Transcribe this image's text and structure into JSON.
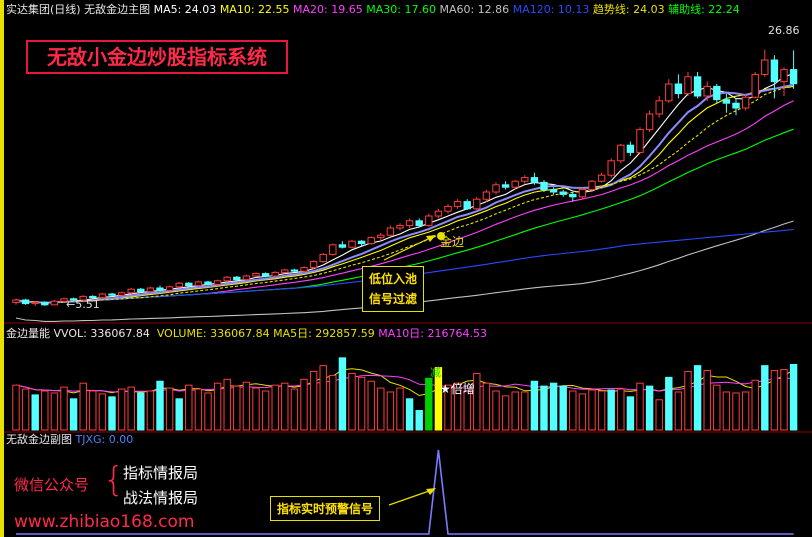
{
  "main_header": {
    "stock": "实达集团(日线)",
    "indicator": "无敌金边主图",
    "ma5": "MA5: 24.03",
    "ma10": "MA10: 22.55",
    "ma20": "MA20: 19.65",
    "ma30": "MA30: 17.60",
    "ma60": "MA60: 12.86",
    "ma120": "MA120: 10.13",
    "trend": "趋势线: 24.03",
    "aux": "辅助线: 22.24"
  },
  "brand_title": "无敌小金边炒股指标系统",
  "annotations": {
    "low_label": "←5.51",
    "high_label": "26.86",
    "golden_edge": "金边",
    "entry_line1": "低位入池",
    "entry_line2": "信号过滤",
    "volume_reduce": "减",
    "volume_double": "★倍增",
    "alert": "指标实时预警信号"
  },
  "volume_header": {
    "name": "金边量能",
    "vvol": "VVOL: 336067.84",
    "volume": "VOLUME: 336067.84",
    "ma5": "MA5日: 292857.59",
    "ma10": "MA10日: 216764.53"
  },
  "sub_header": {
    "name": "无敌金边副图",
    "tjxg": "TJXG: 0.00"
  },
  "promo": {
    "wechat": "微信公众号",
    "brace": "{",
    "item1": "指标情报局",
    "item2": "战法情报局",
    "site": "www.zhibiao168.com"
  },
  "colors": {
    "up": "#ff3c3c",
    "down": "#54ffff",
    "ma5": "#ffffff",
    "ma10": "#ffff00",
    "ma20": "#ff40ff",
    "ma30": "#00ff00",
    "ma60": "#c0c0c0",
    "ma120": "#2a48ff",
    "trend": "#8c8cff",
    "aux": "#e8e000",
    "brand": "#ff2a4a"
  },
  "chart_data": {
    "type": "candlestick",
    "price_range": [
      5.0,
      27.5
    ],
    "candles": [
      [
        5.8,
        6.0,
        5.6,
        6.1
      ],
      [
        6.0,
        5.7,
        5.6,
        6.1
      ],
      [
        5.7,
        5.8,
        5.5,
        5.9
      ],
      [
        5.8,
        5.6,
        5.51,
        5.9
      ],
      [
        5.6,
        5.9,
        5.55,
        6.0
      ],
      [
        5.9,
        6.1,
        5.8,
        6.2
      ],
      [
        6.1,
        6.0,
        5.9,
        6.2
      ],
      [
        6.0,
        6.3,
        5.9,
        6.4
      ],
      [
        6.3,
        6.2,
        6.1,
        6.4
      ],
      [
        6.2,
        6.5,
        6.1,
        6.6
      ],
      [
        6.5,
        6.4,
        6.3,
        6.6
      ],
      [
        6.4,
        6.6,
        6.3,
        6.7
      ],
      [
        6.6,
        6.9,
        6.5,
        7.0
      ],
      [
        6.9,
        6.7,
        6.6,
        7.0
      ],
      [
        6.7,
        7.0,
        6.6,
        7.1
      ],
      [
        7.0,
        6.8,
        6.7,
        7.2
      ],
      [
        6.8,
        7.1,
        6.7,
        7.2
      ],
      [
        7.1,
        7.4,
        7.0,
        7.5
      ],
      [
        7.4,
        7.2,
        7.1,
        7.5
      ],
      [
        7.2,
        7.5,
        7.1,
        7.6
      ],
      [
        7.5,
        7.3,
        7.2,
        7.6
      ],
      [
        7.3,
        7.6,
        7.2,
        7.7
      ],
      [
        7.6,
        7.9,
        7.5,
        8.0
      ],
      [
        7.9,
        7.7,
        7.6,
        8.0
      ],
      [
        7.7,
        8.0,
        7.6,
        8.1
      ],
      [
        8.0,
        8.2,
        7.9,
        8.3
      ],
      [
        8.2,
        8.0,
        7.9,
        8.3
      ],
      [
        8.0,
        8.3,
        7.9,
        8.4
      ],
      [
        8.3,
        8.5,
        8.2,
        8.6
      ],
      [
        8.5,
        8.4,
        8.3,
        8.6
      ],
      [
        8.4,
        8.7,
        8.3,
        8.8
      ],
      [
        8.7,
        9.2,
        8.6,
        9.3
      ],
      [
        9.2,
        9.8,
        9.1,
        9.9
      ],
      [
        9.8,
        10.6,
        9.7,
        10.7
      ],
      [
        10.6,
        10.4,
        10.3,
        10.9
      ],
      [
        10.4,
        10.9,
        10.3,
        11.0
      ],
      [
        10.9,
        10.7,
        10.5,
        11.0
      ],
      [
        10.7,
        11.2,
        10.6,
        11.3
      ],
      [
        11.2,
        11.4,
        11.0,
        11.6
      ],
      [
        11.4,
        12.0,
        11.3,
        12.2
      ],
      [
        12.0,
        12.2,
        11.8,
        12.4
      ],
      [
        12.2,
        12.6,
        12.0,
        12.8
      ],
      [
        12.6,
        12.2,
        12.1,
        12.8
      ],
      [
        12.2,
        13.0,
        12.1,
        13.2
      ],
      [
        13.0,
        13.4,
        12.8,
        13.6
      ],
      [
        13.4,
        13.8,
        13.2,
        14.0
      ],
      [
        13.8,
        14.2,
        13.6,
        14.4
      ],
      [
        14.2,
        13.6,
        13.5,
        14.4
      ],
      [
        13.6,
        14.4,
        13.5,
        14.6
      ],
      [
        14.4,
        15.0,
        14.2,
        15.2
      ],
      [
        15.0,
        15.6,
        14.8,
        15.8
      ],
      [
        15.6,
        15.4,
        15.2,
        15.9
      ],
      [
        15.4,
        15.9,
        15.2,
        16.0
      ],
      [
        15.9,
        16.2,
        15.7,
        16.4
      ],
      [
        16.2,
        15.8,
        15.6,
        16.6
      ],
      [
        15.8,
        15.2,
        15.0,
        16.0
      ],
      [
        15.2,
        15.0,
        14.8,
        15.4
      ],
      [
        15.0,
        14.8,
        14.6,
        15.2
      ],
      [
        14.8,
        14.6,
        14.2,
        15.0
      ],
      [
        14.6,
        15.2,
        14.4,
        15.4
      ],
      [
        15.2,
        15.9,
        15.0,
        16.0
      ],
      [
        15.9,
        16.4,
        15.8,
        16.6
      ],
      [
        16.4,
        17.6,
        16.2,
        17.8
      ],
      [
        17.6,
        18.9,
        17.4,
        19.0
      ],
      [
        18.9,
        18.3,
        18.0,
        19.2
      ],
      [
        18.3,
        20.2,
        18.2,
        20.4
      ],
      [
        20.2,
        21.5,
        20.0,
        21.8
      ],
      [
        21.5,
        22.6,
        21.2,
        23.0
      ],
      [
        22.6,
        24.0,
        22.4,
        24.4
      ],
      [
        24.0,
        23.2,
        22.8,
        24.8
      ],
      [
        23.2,
        24.6,
        23.0,
        25.0
      ],
      [
        24.6,
        23.0,
        22.8,
        25.0
      ],
      [
        23.0,
        23.8,
        22.6,
        24.2
      ],
      [
        23.8,
        22.7,
        22.4,
        24.0
      ],
      [
        22.7,
        22.4,
        21.6,
        23.2
      ],
      [
        22.4,
        22.0,
        21.4,
        22.8
      ],
      [
        22.0,
        22.9,
        21.8,
        23.2
      ],
      [
        22.9,
        24.8,
        22.8,
        25.0
      ],
      [
        24.8,
        26.0,
        24.6,
        26.86
      ],
      [
        26.0,
        24.2,
        22.8,
        26.4
      ],
      [
        24.2,
        25.2,
        23.0,
        25.4
      ],
      [
        25.2,
        24.03,
        23.6,
        26.8
      ]
    ],
    "volume_range": [
      0,
      400000
    ],
    "volumes": [
      [
        230000,
        "up"
      ],
      [
        210000,
        "up"
      ],
      [
        180000,
        "down"
      ],
      [
        200000,
        "up"
      ],
      [
        190000,
        "up"
      ],
      [
        220000,
        "up"
      ],
      [
        160000,
        "down"
      ],
      [
        240000,
        "up"
      ],
      [
        200000,
        "up"
      ],
      [
        185000,
        "up"
      ],
      [
        170000,
        "down"
      ],
      [
        210000,
        "up"
      ],
      [
        220000,
        "up"
      ],
      [
        190000,
        "down"
      ],
      [
        200000,
        "up"
      ],
      [
        250000,
        "down"
      ],
      [
        215000,
        "up"
      ],
      [
        160000,
        "down"
      ],
      [
        230000,
        "up"
      ],
      [
        210000,
        "up"
      ],
      [
        190000,
        "up"
      ],
      [
        240000,
        "up"
      ],
      [
        260000,
        "up"
      ],
      [
        225000,
        "up"
      ],
      [
        245000,
        "up"
      ],
      [
        215000,
        "up"
      ],
      [
        200000,
        "up"
      ],
      [
        230000,
        "up"
      ],
      [
        240000,
        "up"
      ],
      [
        210000,
        "up"
      ],
      [
        260000,
        "up"
      ],
      [
        300000,
        "up"
      ],
      [
        330000,
        "up"
      ],
      [
        280000,
        "up"
      ],
      [
        370000,
        "down"
      ],
      [
        290000,
        "up"
      ],
      [
        270000,
        "up"
      ],
      [
        250000,
        "up"
      ],
      [
        215000,
        "up"
      ],
      [
        195000,
        "up"
      ],
      [
        215000,
        "up"
      ],
      [
        160000,
        "down"
      ],
      [
        100000,
        "down"
      ],
      [
        265000,
        "up"
      ],
      [
        320000,
        "yellow"
      ],
      [
        230000,
        "up"
      ],
      [
        240000,
        "up"
      ],
      [
        200000,
        "up"
      ],
      [
        290000,
        "up"
      ],
      [
        240000,
        "up"
      ],
      [
        200000,
        "up"
      ],
      [
        175000,
        "up"
      ],
      [
        195000,
        "up"
      ],
      [
        195000,
        "up"
      ],
      [
        250000,
        "down"
      ],
      [
        225000,
        "down"
      ],
      [
        240000,
        "down"
      ],
      [
        225000,
        "down"
      ],
      [
        200000,
        "up"
      ],
      [
        185000,
        "up"
      ],
      [
        205000,
        "up"
      ],
      [
        200000,
        "up"
      ],
      [
        205000,
        "down"
      ],
      [
        210000,
        "up"
      ],
      [
        170000,
        "down"
      ],
      [
        240000,
        "up"
      ],
      [
        225000,
        "down"
      ],
      [
        155000,
        "up"
      ],
      [
        270000,
        "down"
      ],
      [
        195000,
        "up"
      ],
      [
        300000,
        "up"
      ],
      [
        330000,
        "down"
      ],
      [
        305000,
        "up"
      ],
      [
        230000,
        "up"
      ],
      [
        195000,
        "up"
      ],
      [
        190000,
        "up"
      ],
      [
        195000,
        "up"
      ],
      [
        255000,
        "up"
      ],
      [
        330000,
        "down"
      ],
      [
        305000,
        "up"
      ],
      [
        310000,
        "up"
      ],
      [
        336067.84,
        "down"
      ]
    ],
    "tjxg": [
      0,
      0,
      0,
      0,
      0,
      0,
      0,
      0,
      0,
      0,
      0,
      0,
      0,
      0,
      0,
      0,
      0,
      0,
      0,
      0,
      0,
      0,
      0,
      0,
      0,
      0,
      0,
      0,
      0,
      0,
      0,
      0,
      0,
      0,
      0,
      0,
      0,
      0,
      0,
      0,
      0,
      0,
      0,
      0,
      1,
      0,
      0,
      0,
      0,
      0,
      0,
      0,
      0,
      0,
      0,
      0,
      0,
      0,
      0,
      0,
      0,
      0,
      0,
      0,
      0,
      0,
      0,
      0,
      0,
      0,
      0,
      0,
      0,
      0,
      0,
      0,
      0,
      0,
      0,
      0,
      0,
      0
    ],
    "series_styles": [
      "ma5",
      "ma10",
      "ma20",
      "ma30",
      "ma60",
      "ma120",
      "trend",
      "aux"
    ]
  }
}
